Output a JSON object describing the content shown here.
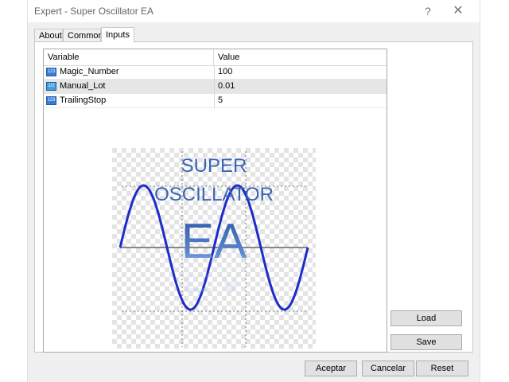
{
  "window": {
    "title": "Expert - Super Oscillator EA",
    "help_glyph": "?",
    "close_glyph": "✕"
  },
  "tabs": [
    {
      "label": "About"
    },
    {
      "label": "Common"
    },
    {
      "label": "Inputs",
      "active": true
    }
  ],
  "grid": {
    "columns": [
      "Variable",
      "Value"
    ],
    "rows": [
      {
        "icon": "integer-type-icon",
        "icon_text": "123",
        "variable": "Magic_Number",
        "value": "100",
        "selected": false
      },
      {
        "icon": "double-type-icon",
        "icon_text": "1/2",
        "variable": "Manual_Lot",
        "value": "0.01",
        "selected": true
      },
      {
        "icon": "integer-type-icon",
        "icon_text": "123",
        "variable": "TrailingStop",
        "value": "5",
        "selected": false
      }
    ]
  },
  "logo": {
    "line1": "SUPER",
    "line2": "OSCILLATOR",
    "line3": "EA",
    "text_color": "#3b64b4",
    "wave_color": "#1d2bcc"
  },
  "buttons": {
    "load": "Load",
    "save": "Save",
    "ok": "Aceptar",
    "cancel": "Cancelar",
    "reset": "Reset"
  }
}
